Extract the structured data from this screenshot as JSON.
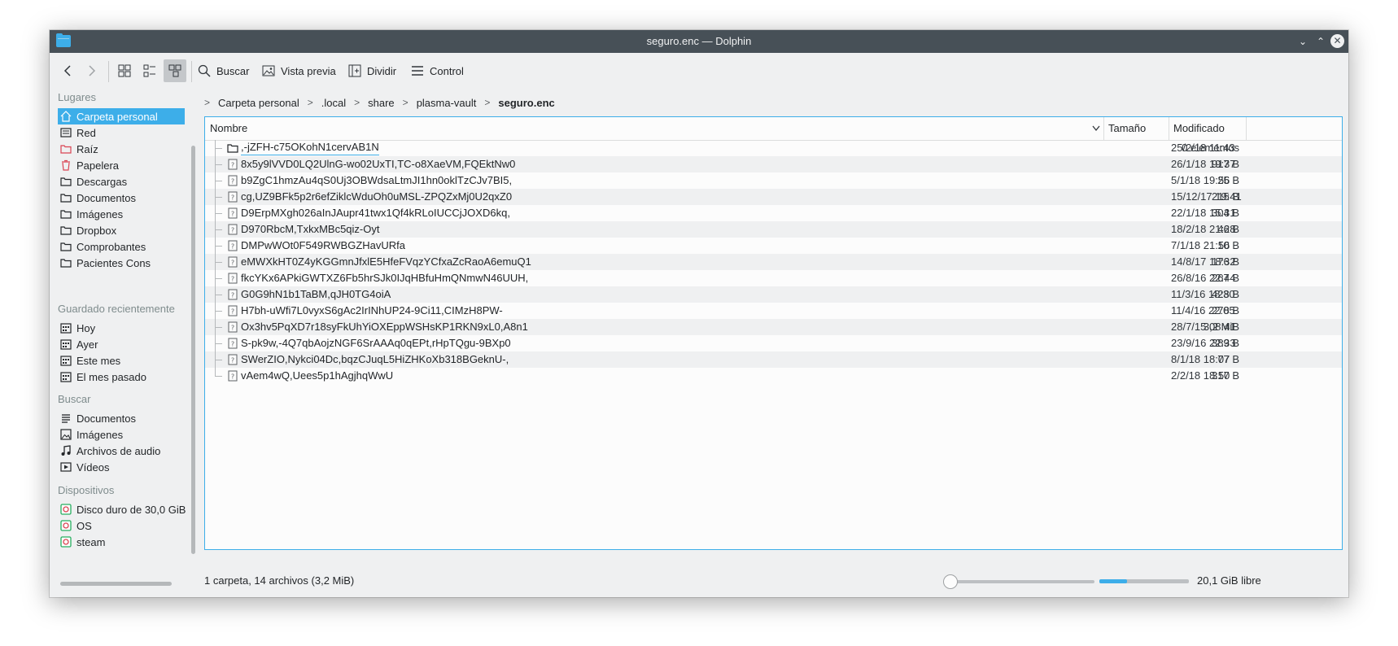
{
  "window": {
    "title": "seguro.enc — Dolphin",
    "minimize_glyph": "⌄",
    "maximize_glyph": "⌃",
    "close_glyph": "✕"
  },
  "toolbar": {
    "search_label": "Buscar",
    "preview_label": "Vista previa",
    "split_label": "Dividir",
    "control_label": "Control"
  },
  "sidebar": {
    "places_header": "Lugares",
    "places": [
      {
        "label": "Carpeta personal",
        "icon": "home-icon"
      },
      {
        "label": "Red",
        "icon": "network-icon"
      },
      {
        "label": "Raíz",
        "icon": "root-folder-icon"
      },
      {
        "label": "Papelera",
        "icon": "trash-icon"
      },
      {
        "label": "Descargas",
        "icon": "folder-icon"
      },
      {
        "label": "Documentos",
        "icon": "folder-icon"
      },
      {
        "label": "Imágenes",
        "icon": "folder-icon"
      },
      {
        "label": "Dropbox",
        "icon": "folder-icon"
      },
      {
        "label": "Comprobantes",
        "icon": "folder-icon"
      },
      {
        "label": "Pacientes Cons",
        "icon": "folder-icon"
      }
    ],
    "recent_header": "Guardado recientemente",
    "recent": [
      {
        "label": "Hoy",
        "icon": "calendar-icon"
      },
      {
        "label": "Ayer",
        "icon": "calendar-icon"
      },
      {
        "label": "Este mes",
        "icon": "calendar-icon"
      },
      {
        "label": "El mes pasado",
        "icon": "calendar-icon"
      }
    ],
    "search_header": "Buscar",
    "search": [
      {
        "label": "Documentos",
        "icon": "document-icon"
      },
      {
        "label": "Imágenes",
        "icon": "image-icon"
      },
      {
        "label": "Archivos de audio",
        "icon": "music-icon"
      },
      {
        "label": "Vídeos",
        "icon": "video-icon"
      }
    ],
    "devices_header": "Dispositivos",
    "devices": [
      {
        "label": "Disco duro de 30,0 GiB",
        "icon": "drive-icon"
      },
      {
        "label": "OS",
        "icon": "drive-icon"
      },
      {
        "label": "steam",
        "icon": "drive-icon"
      }
    ]
  },
  "breadcrumb": {
    "items": [
      "Carpeta personal",
      ".local",
      "share",
      "plasma-vault",
      "seguro.enc"
    ]
  },
  "fileview": {
    "columns": {
      "name": "Nombre",
      "size": "Tamaño",
      "modified": "Modificado"
    },
    "rows": [
      {
        "name": ",-jZFH-c75OKohN1cervAB1N",
        "size": "0 elementos",
        "date": "25/2/18 11:43",
        "type": "folder"
      },
      {
        "name": "8x5y9lVVD0LQ2UlnG-wo02UxTI,TC-o8XaeVM,FQEktNw0",
        "size": "917 B",
        "date": "26/1/18 19:37",
        "type": "file"
      },
      {
        "name": "b9ZgC1hmzAu4qS0Uj3OBWdsaLtmJI1hn0oklTzCJv7BI5,",
        "size": "25 B",
        "date": "5/1/18 19:56",
        "type": "file"
      },
      {
        "name": "cg,UZ9BFk5p2r6efZiklcWduOh0uMSL-ZPQZxMj0U2qxZ0",
        "size": "215 B",
        "date": "15/12/17 19:41",
        "type": "file"
      },
      {
        "name": "D9ErpMXgh026aInJAupr41twx1Qf4kRLoIUCCjJOXD6kq,",
        "size": "304 B",
        "date": "22/1/18 15:31",
        "type": "file"
      },
      {
        "name": "D970RbcM,TxkxMBc5qiz-Oyt",
        "size": "46 B",
        "date": "18/2/18 21:28",
        "type": "file"
      },
      {
        "name": "DMPwWOt0F549RWBGZHavURfa",
        "size": "10 B",
        "date": "7/1/18 21:56",
        "type": "file"
      },
      {
        "name": "eMWXkHT0Z4yKGGmnJfxlE5HfeFVqzYCfxaZcRaoA6emuQ1",
        "size": "176 B",
        "date": "14/8/17 18:32",
        "type": "file"
      },
      {
        "name": "fkcYKx6APkiGWTXZ6Fb5hrSJk0IJqHBfuHmQNmwN46UUH,",
        "size": "267 B",
        "date": "26/8/16 22:44",
        "type": "file"
      },
      {
        "name": "G0G9hN1b1TaBM,qJH0TG4oiA",
        "size": "428 B",
        "date": "11/3/16 18:30",
        "type": "file"
      },
      {
        "name": "H7bh-uWfi7L0vyxS6gAc2IrINhUP24-9Ci11,CIMzH8PW-",
        "size": "278 B",
        "date": "11/4/16 22:05",
        "type": "file"
      },
      {
        "name": "Ox3hv5PqXD7r18syFkUhYiOXEppWSHsKP1RKN9xL0,A8n1",
        "size": "3,2 MiB",
        "date": "28/7/15 08:41",
        "type": "file"
      },
      {
        "name": "S-pk9w,-4Q7qbAojzNGF6SrAAAq0qEPt,rHpTQgu-9BXp0",
        "size": "389 B",
        "date": "23/9/16 22:33",
        "type": "file"
      },
      {
        "name": "SWerZIO,Nykci04Dc,bqzCJuqL5HiZHKoXb318BGeknU-,",
        "size": "77 B",
        "date": "8/1/18 18:07",
        "type": "file"
      },
      {
        "name": "vAem4wQ,Uees5p1hAgjhqWwU",
        "size": "317 B",
        "date": "2/2/18 18:50",
        "type": "file"
      }
    ]
  },
  "statusbar": {
    "summary": "1 carpeta, 14 archivos (3,2 MiB)",
    "free_space": "20,1 GiB libre",
    "used_fraction": 0.31
  },
  "colors": {
    "accent": "#3daee9",
    "titlebar": "#475057",
    "window_bg": "#eff0f1"
  }
}
